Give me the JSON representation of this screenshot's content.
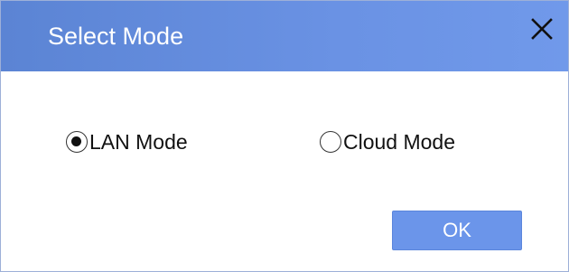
{
  "dialog": {
    "title": "Select Mode",
    "close_icon": "close-icon",
    "options": [
      {
        "label": "LAN Mode",
        "selected": true
      },
      {
        "label": "Cloud Mode",
        "selected": false
      }
    ],
    "ok_label": "OK"
  },
  "colors": {
    "titlebar": "#6a92e4",
    "ok_button": "#6b95ea",
    "text": "#111111"
  }
}
